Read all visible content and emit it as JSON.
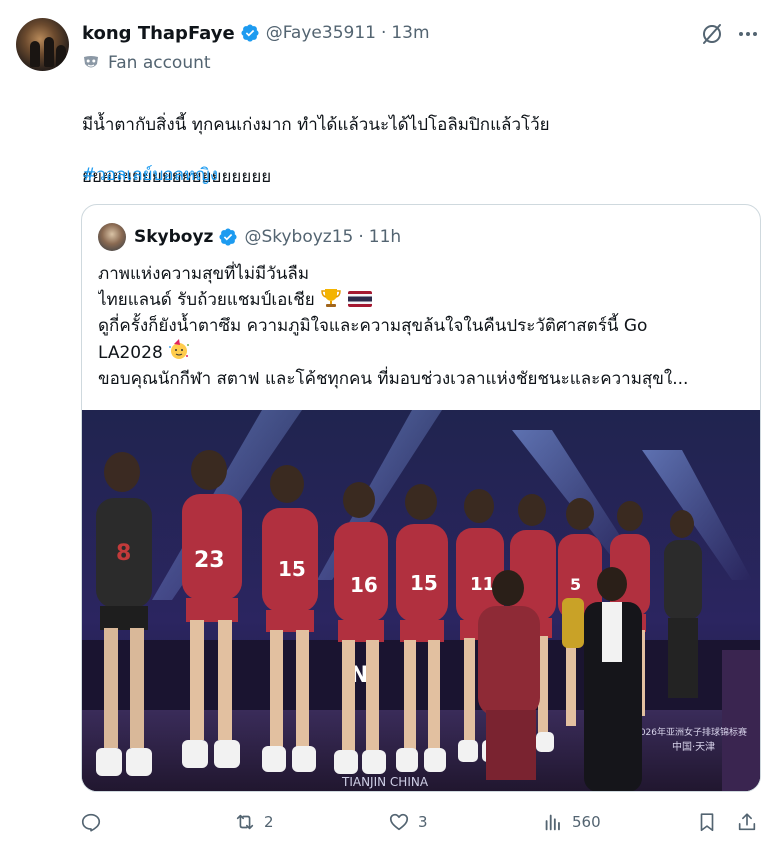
{
  "author": {
    "name": "kong ThapFaye",
    "handle": "@Faye35911",
    "separator": "·",
    "time": "13m",
    "label": "Fan account"
  },
  "tweet": {
    "lines": [
      "มีน้ำตากับสิ่งนี้ ทุกคนเก่งมาก ทำได้แล้วนะได้ไปโอลิมปิกแล้วโว้ย",
      "ยยยยยยยยยยยยยยยยยยย"
    ],
    "hashtag": "#วอลเลย์บอลหญิง"
  },
  "quoted": {
    "name": "Skyboyz",
    "handle": "@Skyboyz15",
    "separator": "·",
    "time": "11h",
    "lines": [
      "ภาพแห่งความสุขที่ไม่มีวันลืม",
      "ไทยแลนด์ รับถ้วยแชมป์เอเชีย",
      "ดูกี่ครั้งก็ยังน้ำตาซึม ความภูมิใจและความสุขล้นใจในคืนประวัติศาสตร์นี้ Go",
      "LA2028",
      "ขอบคุณนักกีฬา สตาฟ และโค้ชทุกคน ที่มอบช่วงเวลาแห่งชัยชนะและความสุขใ..."
    ],
    "emojis": [
      "trophy-emoji",
      "thai-flag-emoji",
      "party-face-emoji"
    ],
    "media": {
      "jersey_numbers": [
        "8",
        "23",
        "15",
        "16",
        "15",
        "11",
        "5"
      ],
      "banner_text": "TIANJIN CHINA",
      "side_text": "2026年亚洲女子排球锦标赛",
      "city_text": "中国·天津",
      "board_text": "IN"
    }
  },
  "actions": {
    "reply": {
      "icon": "reply-icon",
      "count": ""
    },
    "repost": {
      "icon": "repost-icon",
      "count": "2"
    },
    "like": {
      "icon": "like-icon",
      "count": "3"
    },
    "views": {
      "icon": "views-icon",
      "count": "560"
    },
    "bookmark": {
      "icon": "bookmark-icon"
    },
    "share": {
      "icon": "share-icon"
    }
  },
  "colors": {
    "text": "#0f1419",
    "secondary": "#536471",
    "link": "#1d9bf0",
    "verified": "#1d9bf0",
    "border": "#cfd9de",
    "jersey": "#b1303f"
  }
}
